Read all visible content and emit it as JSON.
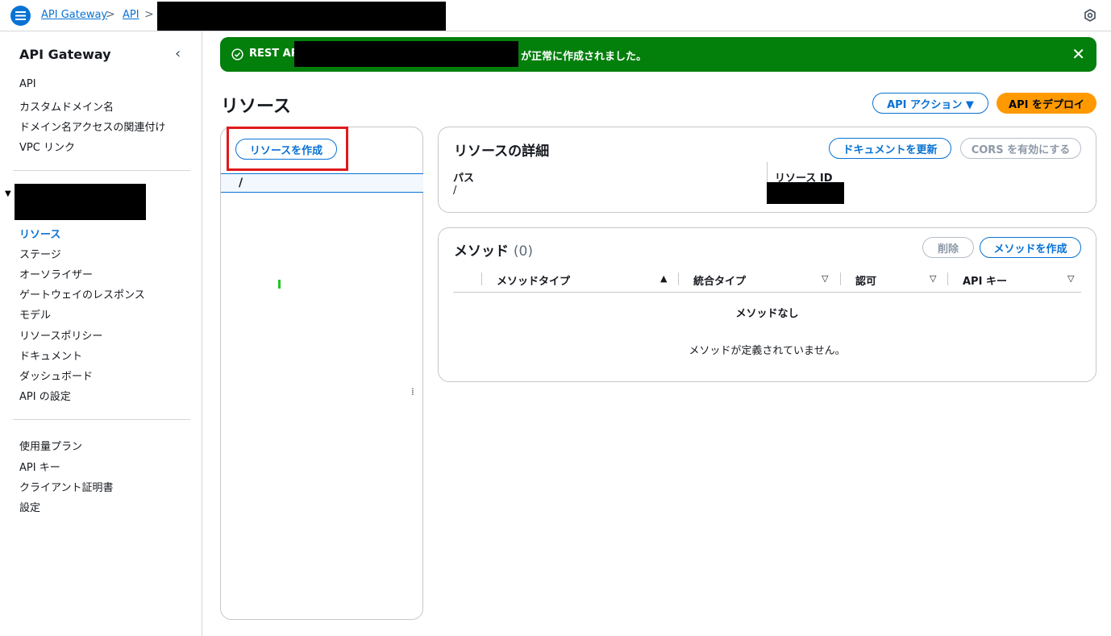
{
  "header": {
    "breadcrumb": [
      "API Gateway",
      "API"
    ],
    "separator": ">"
  },
  "sidebar": {
    "title": "API Gateway",
    "collapse_glyph": "‹",
    "top_items": [
      "API",
      "カスタムドメイン名",
      "ドメイン名アクセスの関連付け",
      "VPC リンク"
    ],
    "api_items": [
      "リソース",
      "ステージ",
      "オーソライザー",
      "ゲートウェイのレスポンス",
      "モデル",
      "リソースポリシー",
      "ドキュメント",
      "ダッシュボード",
      "API の設定"
    ],
    "active_item": "リソース",
    "bottom_items": [
      "使用量プラン",
      "API キー",
      "クライアント証明書",
      "設定"
    ]
  },
  "flash": {
    "prefix": "REST API",
    "suffix": "が正常に作成されました。",
    "close": "✕",
    "color": "#037f0c"
  },
  "page": {
    "title": "リソース",
    "api_actions": "API アクション ▼",
    "deploy": "API をデプロイ"
  },
  "tree": {
    "create_resource": "リソースを作成",
    "root": "/"
  },
  "details": {
    "title": "リソースの詳細",
    "update_docs": "ドキュメントを更新",
    "enable_cors": "CORS を有効にする",
    "path_label": "パス",
    "path_value": "/",
    "id_label": "リソース ID"
  },
  "methods": {
    "title": "メソッド",
    "count": "(0)",
    "delete": "削除",
    "create": "メソッドを作成",
    "columns": [
      "メソッドタイプ",
      "統合タイプ",
      "認可",
      "API キー"
    ],
    "empty_title": "メソッドなし",
    "empty_desc": "メソッドが定義されていません。"
  },
  "colors": {
    "accent": "#0972d3",
    "primary_button": "#ff9900",
    "success": "#037f0c",
    "highlight_box": "#e0191b"
  }
}
